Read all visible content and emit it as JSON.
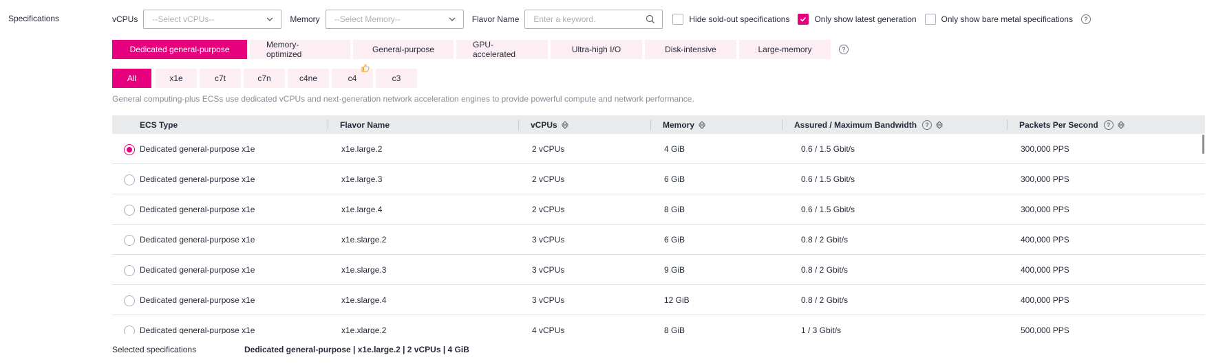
{
  "section_label": "Specifications",
  "filters": {
    "vcpus_label": "vCPUs",
    "vcpus_value": "--Select vCPUs--",
    "memory_label": "Memory",
    "memory_value": "--Select Memory--",
    "flavor_label": "Flavor Name",
    "flavor_placeholder": "Enter a keyword.",
    "hide_sold_out": {
      "label": "Hide sold-out specifications",
      "checked": false
    },
    "latest_generation": {
      "label": "Only show latest generation",
      "checked": true
    },
    "bare_metal": {
      "label": "Only show bare metal specifications",
      "checked": false
    }
  },
  "categories": [
    {
      "label": "Dedicated general-purpose",
      "active": true
    },
    {
      "label": "Memory-optimized",
      "active": false
    },
    {
      "label": "General-purpose",
      "active": false
    },
    {
      "label": "GPU-accelerated",
      "active": false
    },
    {
      "label": "Ultra-high I/O",
      "active": false
    },
    {
      "label": "Disk-intensive",
      "active": false
    },
    {
      "label": "Large-memory",
      "active": false
    }
  ],
  "series": [
    {
      "label": "All",
      "active": true
    },
    {
      "label": "x1e",
      "active": false
    },
    {
      "label": "c7t",
      "active": false
    },
    {
      "label": "c7n",
      "active": false
    },
    {
      "label": "c4ne",
      "active": false
    },
    {
      "label": "c4",
      "active": false,
      "recommended": true
    },
    {
      "label": "c3",
      "active": false
    }
  ],
  "description": "General computing-plus ECSs use dedicated vCPUs and next-generation network acceleration engines to provide powerful compute and network performance.",
  "table": {
    "headers": {
      "type": "ECS Type",
      "flavor": "Flavor Name",
      "vcpus": "vCPUs",
      "memory": "Memory",
      "bandwidth": "Assured / Maximum Bandwidth",
      "pps": "Packets Per Second"
    },
    "rows": [
      {
        "type": "Dedicated general-purpose x1e",
        "flavor": "x1e.large.2",
        "vcpus": "2 vCPUs",
        "memory": "4 GiB",
        "bandwidth": "0.6 / 1.5 Gbit/s",
        "pps": "300,000 PPS",
        "selected": true
      },
      {
        "type": "Dedicated general-purpose x1e",
        "flavor": "x1e.large.3",
        "vcpus": "2 vCPUs",
        "memory": "6 GiB",
        "bandwidth": "0.6 / 1.5 Gbit/s",
        "pps": "300,000 PPS",
        "selected": false
      },
      {
        "type": "Dedicated general-purpose x1e",
        "flavor": "x1e.large.4",
        "vcpus": "2 vCPUs",
        "memory": "8 GiB",
        "bandwidth": "0.6 / 1.5 Gbit/s",
        "pps": "300,000 PPS",
        "selected": false
      },
      {
        "type": "Dedicated general-purpose x1e",
        "flavor": "x1e.slarge.2",
        "vcpus": "3 vCPUs",
        "memory": "6 GiB",
        "bandwidth": "0.8 / 2 Gbit/s",
        "pps": "400,000 PPS",
        "selected": false
      },
      {
        "type": "Dedicated general-purpose x1e",
        "flavor": "x1e.slarge.3",
        "vcpus": "3 vCPUs",
        "memory": "9 GiB",
        "bandwidth": "0.8 / 2 Gbit/s",
        "pps": "400,000 PPS",
        "selected": false
      },
      {
        "type": "Dedicated general-purpose x1e",
        "flavor": "x1e.slarge.4",
        "vcpus": "3 vCPUs",
        "memory": "12 GiB",
        "bandwidth": "0.8 / 2 Gbit/s",
        "pps": "400,000 PPS",
        "selected": false
      },
      {
        "type": "Dedicated general-purpose x1e",
        "flavor": "x1e.xlarge.2",
        "vcpus": "4 vCPUs",
        "memory": "8 GiB",
        "bandwidth": "1 / 3 Gbit/s",
        "pps": "500,000 PPS",
        "selected": false
      }
    ]
  },
  "selected": {
    "label": "Selected specifications",
    "value": "Dedicated general-purpose | x1e.large.2 | 2 vCPUs | 4 GiB"
  },
  "colors": {
    "accent": "#e6007e",
    "accent_light": "#fdeef4",
    "header_bg": "#e9eaec"
  }
}
